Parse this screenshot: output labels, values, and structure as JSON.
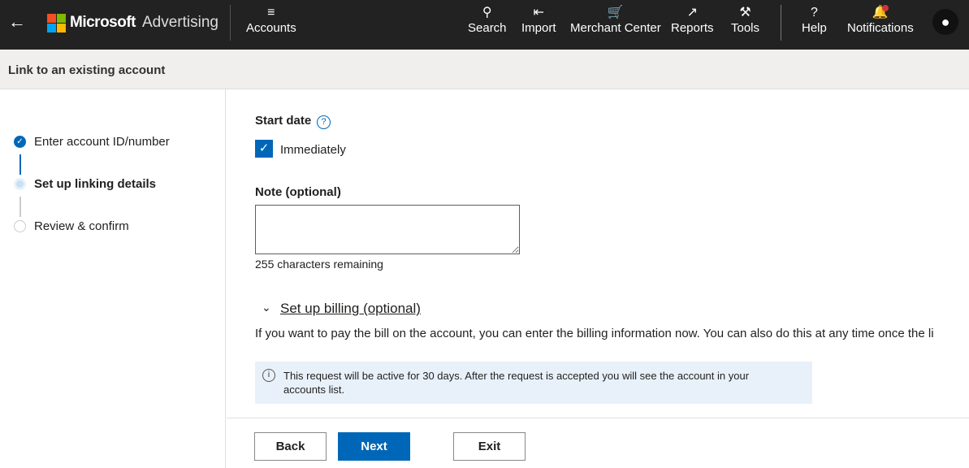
{
  "header": {
    "brand": "Microsoft",
    "product": "Advertising",
    "nav": [
      {
        "label": "Accounts",
        "icon": "accounts-list-icon"
      },
      {
        "label": "Search",
        "icon": "search-icon"
      },
      {
        "label": "Import",
        "icon": "import-icon"
      },
      {
        "label": "Merchant Center",
        "icon": "cart-icon"
      },
      {
        "label": "Reports",
        "icon": "chart-icon"
      },
      {
        "label": "Tools",
        "icon": "wrench-icon"
      },
      {
        "label": "Help",
        "icon": "help-icon"
      },
      {
        "label": "Notifications",
        "icon": "bell-icon"
      }
    ]
  },
  "page_title": "Link to an existing account",
  "steps": [
    {
      "label": "Enter account ID/number",
      "state": "complete"
    },
    {
      "label": "Set up linking details",
      "state": "current"
    },
    {
      "label": "Review & confirm",
      "state": "pending"
    }
  ],
  "form": {
    "start_date_label": "Start date",
    "immediately_label": "Immediately",
    "immediately_checked": true,
    "note_label": "Note (optional)",
    "note_value": "",
    "chars_remaining": "255 characters remaining",
    "billing_toggle": "Set up billing (optional)",
    "billing_text": "If you want to pay the bill on the account, you can enter the billing information now. You can also do this at any time once the li",
    "info": "This request will be active for 30 days. After the request is accepted you will see the account in your accounts list."
  },
  "buttons": {
    "back": "Back",
    "next": "Next",
    "exit": "Exit"
  },
  "colors": {
    "accent": "#0067b8",
    "topbar": "#222222",
    "info_bg": "#e8f1fa",
    "notification_dot": "#d13438"
  }
}
